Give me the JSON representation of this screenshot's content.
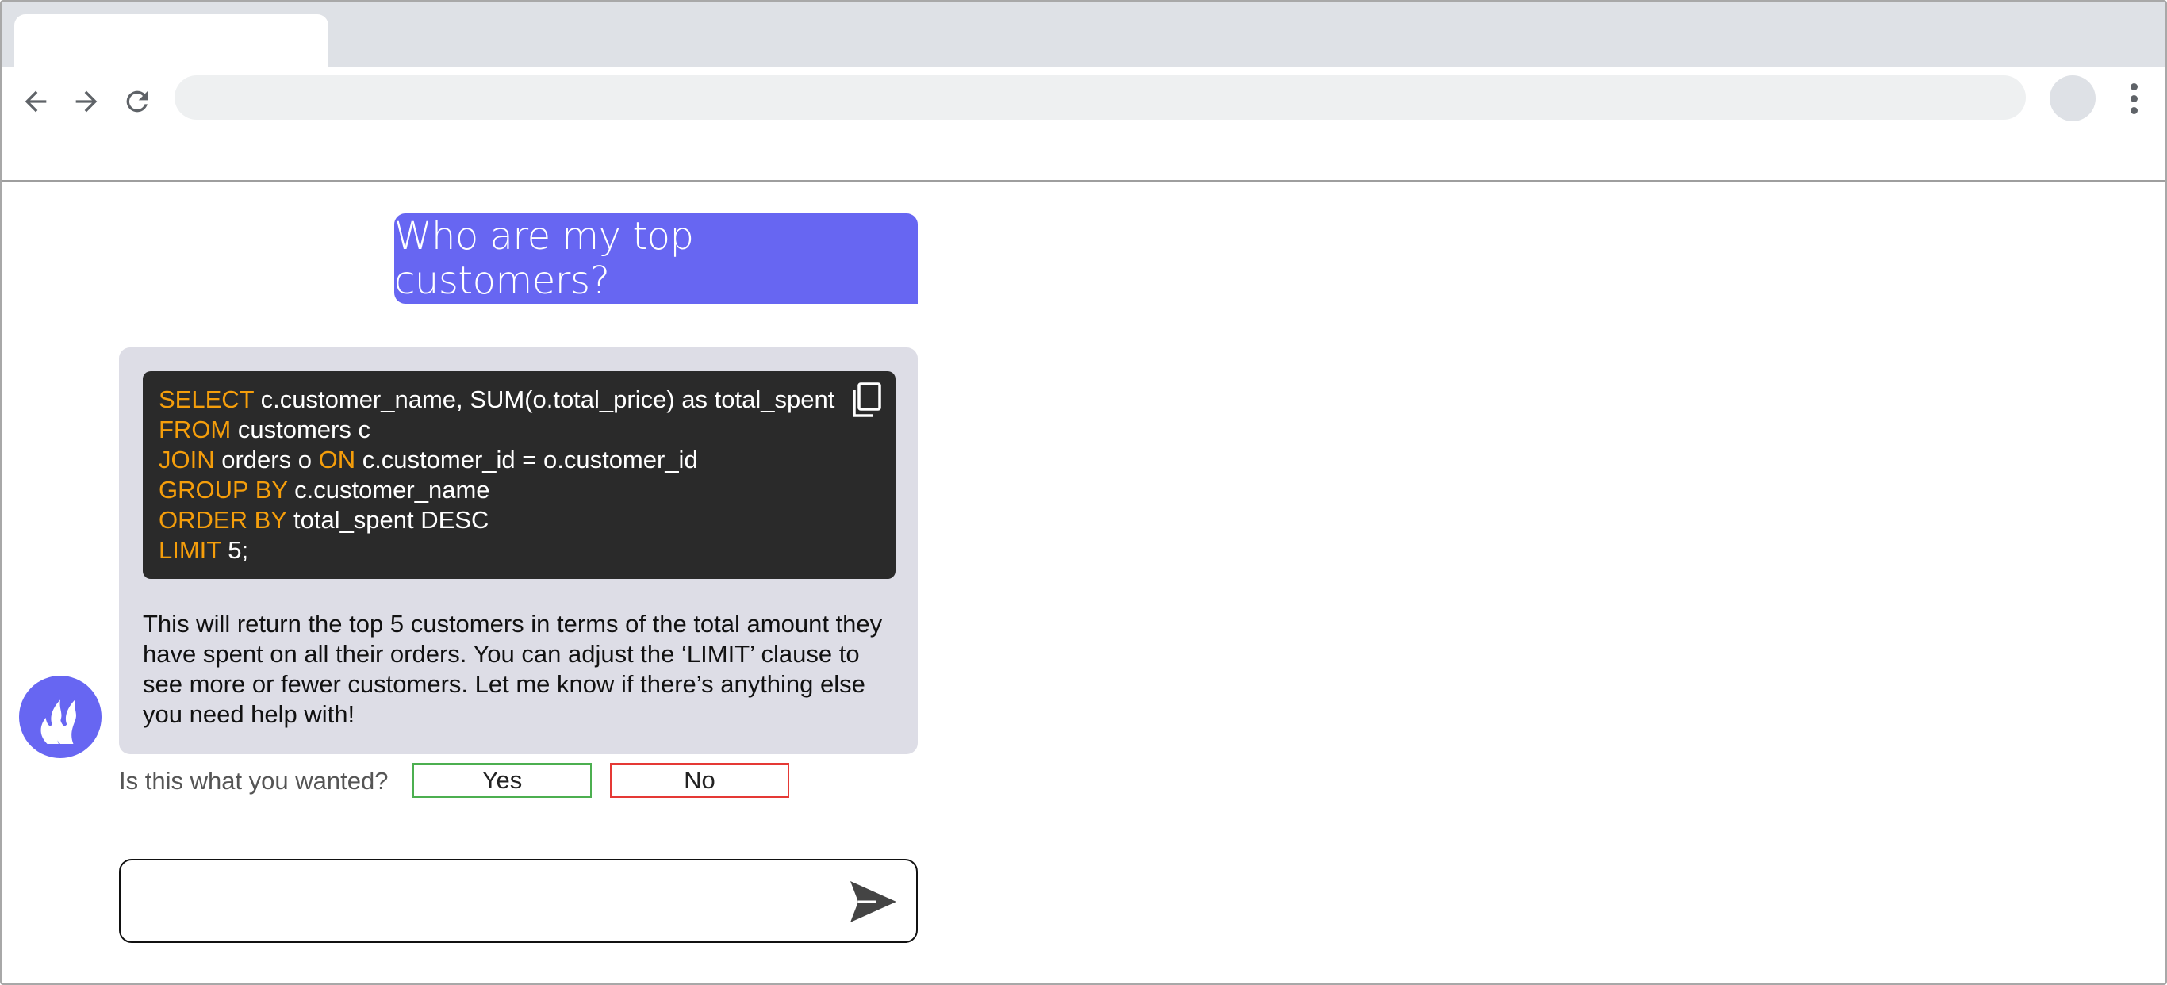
{
  "browser": {
    "url": "",
    "tab_title": ""
  },
  "chat": {
    "user_message": "Who are my top customers?",
    "code_lines": [
      [
        {
          "kw": "SELECT"
        },
        {
          "t": " c.customer_name, SUM(o.total_price) as total_spent"
        }
      ],
      [
        {
          "kw": "FROM"
        },
        {
          "t": " customers c"
        }
      ],
      [
        {
          "kw": "JOIN"
        },
        {
          "t": " orders o "
        },
        {
          "kw": "ON"
        },
        {
          "t": " c.customer_id = o.customer_id"
        }
      ],
      [
        {
          "kw": "GROUP BY"
        },
        {
          "t": " c.customer_name"
        }
      ],
      [
        {
          "kw": "ORDER BY"
        },
        {
          "t": " total_spent DESC"
        }
      ],
      [
        {
          "kw": "LIMIT"
        },
        {
          "t": " 5;"
        }
      ]
    ],
    "bot_explanation": "This will return the top 5 customers in terms of the total amount they have spent on all their orders. You can adjust the ‘LIMIT’ clause to see more or fewer customers. Let me know if there’s anything else you need help with!",
    "feedback": {
      "question": "Is this what you wanted?",
      "yes_label": "Yes",
      "no_label": "No"
    },
    "composer_placeholder": ""
  },
  "icons": {
    "back": "arrow-left-icon",
    "forward": "arrow-right-icon",
    "reload": "reload-icon",
    "menu": "kebab-menu-icon",
    "copy": "copy-icon",
    "avatar": "flame-logo-icon",
    "send": "send-icon"
  },
  "colors": {
    "user_bubble": "#6766f2",
    "bot_bubble": "#dddde6",
    "code_bg": "#2a2a2a",
    "keyword": "#f59e0b",
    "yes_border": "#4caf50",
    "no_border": "#e53935"
  }
}
